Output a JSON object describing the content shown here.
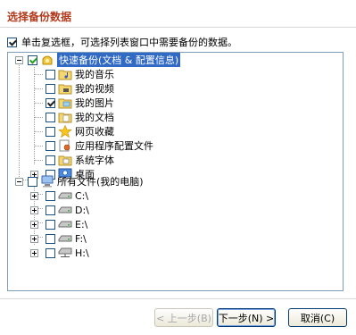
{
  "dialog": {
    "title": "选择备份数据",
    "instruction": "单击复选框，可选择列表窗口中需要备份的数据。",
    "instruction_checked": true
  },
  "tree": {
    "quick_backup": {
      "label": "快速备份(文档 & 配置信息)",
      "checked": true,
      "expanded": true,
      "children": [
        {
          "label": "我的音乐",
          "checked": false,
          "icon": "music-folder-icon"
        },
        {
          "label": "我的视频",
          "checked": false,
          "icon": "video-folder-icon"
        },
        {
          "label": "我的图片",
          "checked": true,
          "icon": "pictures-folder-icon"
        },
        {
          "label": "我的文档",
          "checked": false,
          "icon": "documents-folder-icon"
        },
        {
          "label": "网页收藏",
          "checked": false,
          "icon": "favorites-star-icon"
        },
        {
          "label": "应用程序配置文件",
          "checked": false,
          "icon": "app-config-icon"
        },
        {
          "label": "系统字体",
          "checked": false,
          "icon": "fonts-folder-icon"
        },
        {
          "label": "桌面",
          "checked": false,
          "icon": "desktop-icon",
          "expandable": true
        }
      ]
    },
    "all_files": {
      "label": "所有文件(我的电脑)",
      "checked": false,
      "expanded": true,
      "children": [
        {
          "label": "C:\\",
          "checked": false,
          "icon": "drive-icon"
        },
        {
          "label": "D:\\",
          "checked": false,
          "icon": "drive-icon"
        },
        {
          "label": "E:\\",
          "checked": false,
          "icon": "drive-icon"
        },
        {
          "label": "F:\\",
          "checked": false,
          "icon": "drive-icon"
        },
        {
          "label": "H:\\",
          "checked": false,
          "icon": "network-drive-icon"
        }
      ]
    }
  },
  "buttons": {
    "back": "< 上一步(B)",
    "next": "下一步(N) >",
    "cancel": "取消(C)"
  },
  "colors": {
    "title": "#b23a1c",
    "selection": "#316ac5",
    "checkmark": "#21a121",
    "panel_border": "#7f9db9"
  }
}
